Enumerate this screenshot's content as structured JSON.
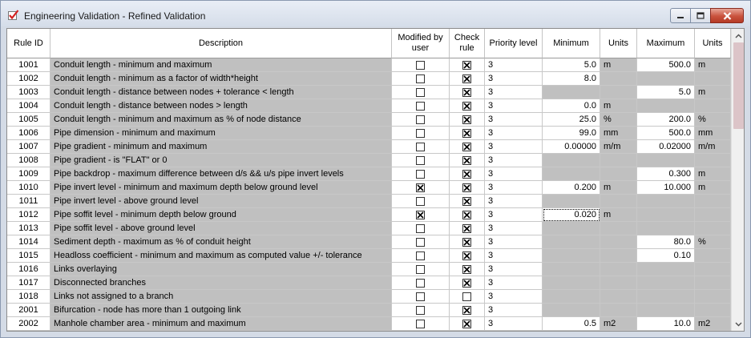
{
  "window": {
    "title": "Engineering Validation - Refined Validation",
    "icons": {
      "app": "red-check-icon",
      "minimize": "minimize-icon",
      "maximize": "maximize-icon",
      "close": "close-icon"
    }
  },
  "grid": {
    "headers": {
      "rule_id": "Rule ID",
      "description": "Description",
      "modified": "Modified by user",
      "check": "Check rule",
      "priority": "Priority level",
      "minimum": "Minimum",
      "units_min": "Units",
      "maximum": "Maximum",
      "units_max": "Units"
    },
    "rows": [
      {
        "id": "1001",
        "desc": "Conduit length - minimum and maximum",
        "modified": false,
        "check": true,
        "priority": "3",
        "min": "5.0",
        "min_units": "m",
        "max": "500.0",
        "max_units": "m",
        "min_enabled": true,
        "max_enabled": true
      },
      {
        "id": "1002",
        "desc": "Conduit length - minimum as a factor of width*height",
        "modified": false,
        "check": true,
        "priority": "3",
        "min": "8.0",
        "min_units": "",
        "max": "",
        "max_units": "",
        "min_enabled": true,
        "max_enabled": false
      },
      {
        "id": "1003",
        "desc": "Conduit length - distance between nodes + tolerance < length",
        "modified": false,
        "check": true,
        "priority": "3",
        "min": "",
        "min_units": "",
        "max": "5.0",
        "max_units": "m",
        "min_enabled": false,
        "max_enabled": true
      },
      {
        "id": "1004",
        "desc": "Conduit length - distance between nodes > length",
        "modified": false,
        "check": true,
        "priority": "3",
        "min": "0.0",
        "min_units": "m",
        "max": "",
        "max_units": "",
        "min_enabled": true,
        "max_enabled": false
      },
      {
        "id": "1005",
        "desc": "Conduit length - minimum and maximum as % of node distance",
        "modified": false,
        "check": true,
        "priority": "3",
        "min": "25.0",
        "min_units": "%",
        "max": "200.0",
        "max_units": "%",
        "min_enabled": true,
        "max_enabled": true
      },
      {
        "id": "1006",
        "desc": "Pipe dimension - minimum and maximum",
        "modified": false,
        "check": true,
        "priority": "3",
        "min": "99.0",
        "min_units": "mm",
        "max": "500.0",
        "max_units": "mm",
        "min_enabled": true,
        "max_enabled": true
      },
      {
        "id": "1007",
        "desc": "Pipe gradient - minimum and maximum",
        "modified": false,
        "check": true,
        "priority": "3",
        "min": "0.00000",
        "min_units": "m/m",
        "max": "0.02000",
        "max_units": "m/m",
        "min_enabled": true,
        "max_enabled": true
      },
      {
        "id": "1008",
        "desc": "Pipe gradient - is \"FLAT\" or 0",
        "modified": false,
        "check": true,
        "priority": "3",
        "min": "",
        "min_units": "",
        "max": "",
        "max_units": "",
        "min_enabled": false,
        "max_enabled": false
      },
      {
        "id": "1009",
        "desc": "Pipe backdrop - maximum difference between d/s && u/s pipe invert levels",
        "modified": false,
        "check": true,
        "priority": "3",
        "min": "",
        "min_units": "",
        "max": "0.300",
        "max_units": "m",
        "min_enabled": false,
        "max_enabled": true
      },
      {
        "id": "1010",
        "desc": "Pipe invert level - minimum and maximum depth below ground level",
        "modified": true,
        "check": true,
        "priority": "3",
        "min": "0.200",
        "min_units": "m",
        "max": "10.000",
        "max_units": "m",
        "min_enabled": true,
        "max_enabled": true
      },
      {
        "id": "1011",
        "desc": "Pipe invert level - above ground level",
        "modified": false,
        "check": true,
        "priority": "3",
        "min": "",
        "min_units": "",
        "max": "",
        "max_units": "",
        "min_enabled": false,
        "max_enabled": false
      },
      {
        "id": "1012",
        "desc": "Pipe soffit level - minimum depth below ground",
        "modified": true,
        "check": true,
        "priority": "3",
        "min": "0.020",
        "min_units": "m",
        "max": "",
        "max_units": "",
        "min_enabled": true,
        "max_enabled": false,
        "focused": true
      },
      {
        "id": "1013",
        "desc": "Pipe soffit level - above ground level",
        "modified": false,
        "check": true,
        "priority": "3",
        "min": "",
        "min_units": "",
        "max": "",
        "max_units": "",
        "min_enabled": false,
        "max_enabled": false
      },
      {
        "id": "1014",
        "desc": "Sediment depth - maximum as % of conduit height",
        "modified": false,
        "check": true,
        "priority": "3",
        "min": "",
        "min_units": "",
        "max": "80.0",
        "max_units": "%",
        "min_enabled": false,
        "max_enabled": true
      },
      {
        "id": "1015",
        "desc": "Headloss coefficient - minimum and maximum as computed value +/- tolerance",
        "modified": false,
        "check": true,
        "priority": "3",
        "min": "",
        "min_units": "",
        "max": "0.10",
        "max_units": "",
        "min_enabled": false,
        "max_enabled": true
      },
      {
        "id": "1016",
        "desc": "Links overlaying",
        "modified": false,
        "check": true,
        "priority": "3",
        "min": "",
        "min_units": "",
        "max": "",
        "max_units": "",
        "min_enabled": false,
        "max_enabled": false
      },
      {
        "id": "1017",
        "desc": "Disconnected branches",
        "modified": false,
        "check": true,
        "priority": "3",
        "min": "",
        "min_units": "",
        "max": "",
        "max_units": "",
        "min_enabled": false,
        "max_enabled": false
      },
      {
        "id": "1018",
        "desc": "Links not assigned to a branch",
        "modified": false,
        "check": false,
        "priority": "3",
        "min": "",
        "min_units": "",
        "max": "",
        "max_units": "",
        "min_enabled": false,
        "max_enabled": false
      },
      {
        "id": "2001",
        "desc": "Bifurcation - node has more than 1 outgoing link",
        "modified": false,
        "check": true,
        "priority": "3",
        "min": "",
        "min_units": "",
        "max": "",
        "max_units": "",
        "min_enabled": false,
        "max_enabled": false
      },
      {
        "id": "2002",
        "desc": "Manhole chamber area - minimum and maximum",
        "modified": false,
        "check": true,
        "priority": "3",
        "min": "0.5",
        "min_units": "m2",
        "max": "10.0",
        "max_units": "m2",
        "min_enabled": true,
        "max_enabled": true
      }
    ]
  },
  "scrollbar": {
    "up_icon": "chevron-up-icon",
    "down_icon": "chevron-down-icon"
  }
}
